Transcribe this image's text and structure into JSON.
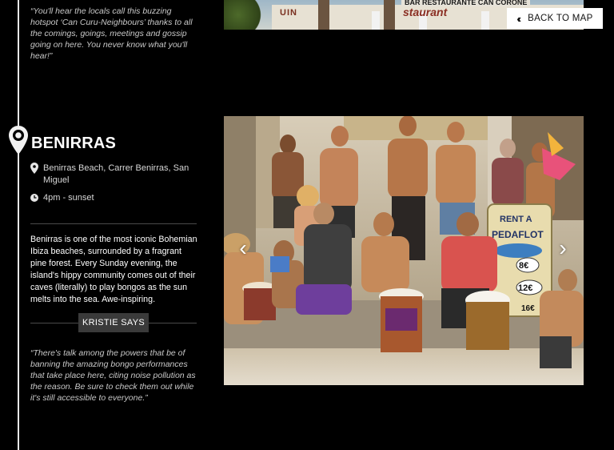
{
  "top_quote": "“You'll hear the locals call this buzzing hotspot ‘Can Curu-Neighbours’ thanks to all the comings, goings, meetings and gossip going on here. You never know what you'll hear!”",
  "top_photo": {
    "sign_left": "UIN",
    "sign_bar": "BAR RESTAURANTE CAN CORONE",
    "sign_main": "staurant"
  },
  "back_button": {
    "label": "BACK TO MAP"
  },
  "location": {
    "title": "BENIRRAS",
    "address": "Benirras Beach, Carrer Benirras, San Miguel",
    "hours": "4pm - sunset",
    "description": "Benirras is one of the most iconic Bohemian Ibiza beaches, surrounded by a fragrant pine forest. Every Sunday evening, the island's hippy community comes out of their caves (literally) to play bongos as the sun melts into the sea. Awe-inspiring."
  },
  "kristie": {
    "badge": "KRISTIE SAYS",
    "quote": "“There's talk among the powers that be of banning the amazing bongo performances that take place here, citing noise pollution as the reason. Be sure to check them out while it's still accessible to everyone.”"
  },
  "photo_sign": [
    "RENT A",
    "PEDAFLOT",
    "8€",
    "12€",
    "16€"
  ],
  "icons": {
    "marker": "location-marker-icon",
    "pin": "map-pin-icon",
    "clock": "clock-icon",
    "back": "double-chevron-left-icon",
    "prev": "chevron-left-icon",
    "next": "chevron-right-icon"
  },
  "colors": {
    "background": "#000000",
    "timeline": "#e8e8e8",
    "badge": "#3a3a3a"
  }
}
